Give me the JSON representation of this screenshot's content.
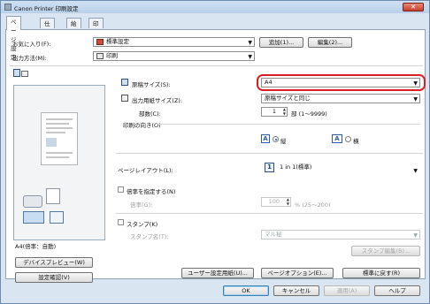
{
  "window": {
    "title": "Canon Printer 印刷設定",
    "close_label": "✕"
  },
  "tabs": [
    {
      "label": "ページ設定",
      "active": true
    },
    {
      "label": "仕上げ",
      "active": false
    },
    {
      "label": "給紙",
      "active": false
    },
    {
      "label": "印刷品質",
      "active": false
    }
  ],
  "favorites": {
    "label": "お気に入り(F):",
    "value": "標準設定",
    "icon": "favorite-settings-icon",
    "add_button": "追加(1)...",
    "edit_button": "編集(2)..."
  },
  "output": {
    "label": "出力方法(M):",
    "value": "印刷",
    "icon": "printer-icon"
  },
  "preview": {
    "caption": "A4(倍率：自動)",
    "device_preview_button": "デバイスプレビュー(W)",
    "settings_check_button": "設定確認(V)"
  },
  "paper": {
    "original_size_label": "原稿サイズ(S):",
    "original_size_value": "A4",
    "output_size_label": "出力用紙サイズ(Z):",
    "output_size_value": "原稿サイズと同じ",
    "copies_label": "部数(C):",
    "copies_value": "1",
    "copies_unit": "部 (1～9999)"
  },
  "orientation": {
    "label": "印刷の向き(O)",
    "portrait_label": "縦",
    "landscape_label": "横",
    "selected": "portrait"
  },
  "layout": {
    "label": "ページレイアウト(L):",
    "value": "1 in 1(標準)",
    "icon_text": "1"
  },
  "scale": {
    "checkbox_label": "倍率を指定する(N)",
    "field_label": "倍率(G):",
    "value": "100",
    "unit": "% (25～200)"
  },
  "stamp": {
    "checkbox_label": "スタンプ(K)",
    "field_label": "スタンプ名(T):",
    "value": "マル秘",
    "edit_button": "スタンプ編集(B)..."
  },
  "bottom_buttons": {
    "user_paper": "ユーザー設定用紙(U)...",
    "page_options": "ページオプション(E)...",
    "restore_default": "標準に戻す(R)"
  },
  "dialog_buttons": {
    "ok": "OK",
    "cancel": "キャンセル",
    "apply": "適用(A)",
    "help": "ヘルプ"
  }
}
